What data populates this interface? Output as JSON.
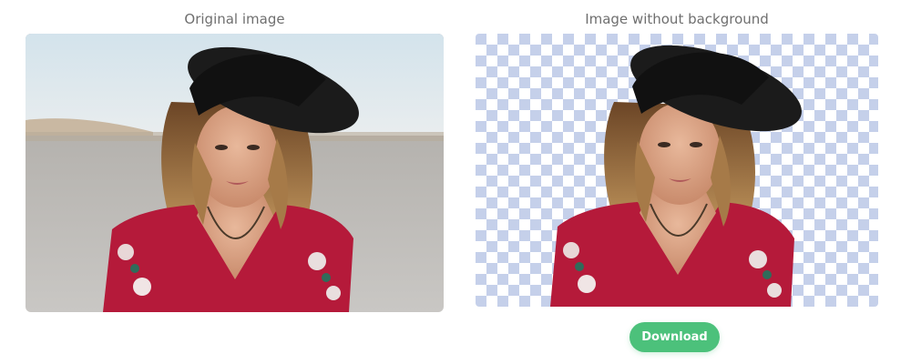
{
  "captions": {
    "original": "Original image",
    "cutout": "Image without background"
  },
  "images": {
    "original": {
      "subject": "woman wearing black hat and red floral top",
      "background": "desert sky"
    },
    "cutout": {
      "subject": "woman wearing black hat and red floral top",
      "background": "transparent checkerboard"
    }
  },
  "actions": {
    "download_label": "Download"
  },
  "colors": {
    "accent": "#4cc17b",
    "caption": "#6f6f6f",
    "checker_a": "#ffffff",
    "checker_b": "#c5d0ea"
  }
}
